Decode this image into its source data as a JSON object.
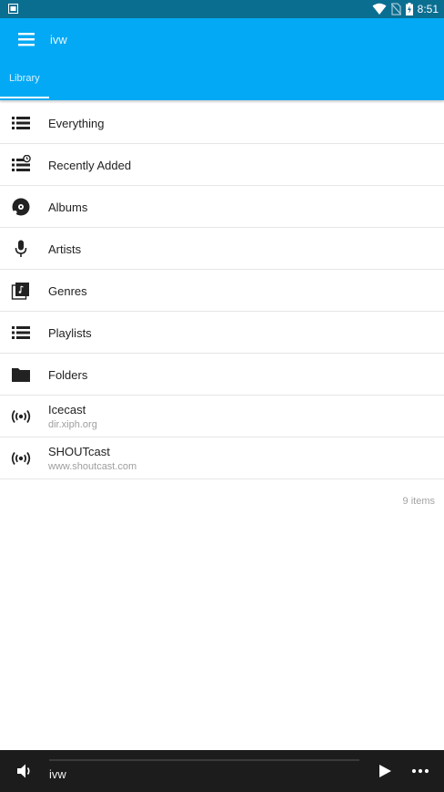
{
  "status_bar": {
    "time": "8:51"
  },
  "app_bar": {
    "title": "ivw"
  },
  "tabs": [
    {
      "label": "Library",
      "selected": true
    }
  ],
  "library_items": [
    {
      "label": "Everything",
      "icon": "list-icon"
    },
    {
      "label": "Recently Added",
      "icon": "recent-list-icon"
    },
    {
      "label": "Albums",
      "icon": "album-disc-icon"
    },
    {
      "label": "Artists",
      "icon": "microphone-icon"
    },
    {
      "label": "Genres",
      "icon": "genre-music-note-icon"
    },
    {
      "label": "Playlists",
      "icon": "playlist-icon"
    },
    {
      "label": "Folders",
      "icon": "folder-icon"
    },
    {
      "label": "Icecast",
      "subtitle": "dir.xiph.org",
      "icon": "radio-broadcast-icon"
    },
    {
      "label": "SHOUTcast",
      "subtitle": "www.shoutcast.com",
      "icon": "radio-broadcast-icon"
    }
  ],
  "item_count": "9 items",
  "player": {
    "track_title": "ivw",
    "progress": 0
  },
  "colors": {
    "status_bar": "#0a6e91",
    "app_bar": "#03a9f4",
    "player_bar": "#1c1c1c",
    "divider": "#e6e6e6"
  }
}
